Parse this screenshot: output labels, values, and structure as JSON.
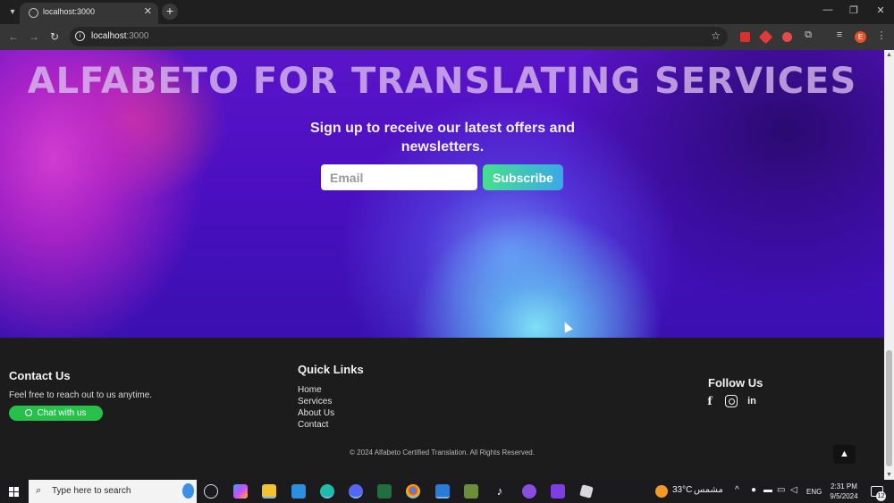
{
  "browser": {
    "tab_title": "localhost:3000",
    "new_tab_label": "+",
    "url_host": "localhost",
    "url_port": ":3000",
    "profile_initial": "E"
  },
  "hero": {
    "title": "ALFABETO FOR TRANSLATING SERVICES",
    "signup_text": "Sign up to receive our latest offers and newsletters.",
    "email_placeholder": "Email",
    "subscribe_label": "Subscribe"
  },
  "footer": {
    "contact": {
      "title": "Contact Us",
      "text": "Feel free to reach out to us anytime.",
      "chat_label": "Chat with us"
    },
    "quick_links": {
      "title": "Quick Links",
      "items": [
        "Home",
        "Services",
        "About Us",
        "Contact"
      ]
    },
    "follow": {
      "title": "Follow Us",
      "icons": [
        "facebook-icon",
        "instagram-icon",
        "linkedin-icon"
      ]
    },
    "copyright": "© 2024 Alfabeto Certified Translation. All Rights Reserved."
  },
  "taskbar": {
    "search_placeholder": "Type here to search",
    "temperature": "33°C",
    "weather_text": "مشمس",
    "language": "ENG",
    "time": "2:31 PM",
    "date": "9/5/2024",
    "notification_count": "12"
  },
  "colors": {
    "subscribe_gradient_start": "#46e08c",
    "subscribe_gradient_end": "#3aa8e8",
    "chat_button": "#27c04b",
    "footer_bg": "#1c1c1c"
  }
}
